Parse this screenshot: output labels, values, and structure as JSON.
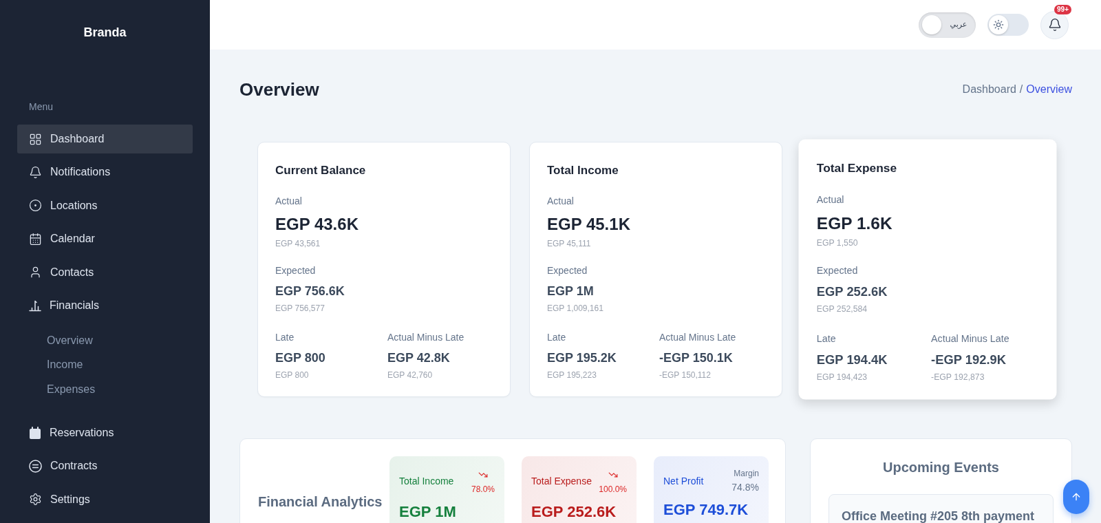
{
  "sidebar": {
    "brand": "Branda",
    "section_label": "Menu",
    "items": [
      {
        "label": "Dashboard",
        "selected": true
      },
      {
        "label": "Notifications",
        "selected": false
      },
      {
        "label": "Locations",
        "selected": false
      },
      {
        "label": "Calendar",
        "selected": false
      },
      {
        "label": "Contacts",
        "selected": false
      },
      {
        "label": "Financials",
        "selected": false,
        "expanded": true,
        "children": [
          {
            "label": "Overview",
            "selected": false
          },
          {
            "label": "Income",
            "selected": false
          },
          {
            "label": "Expenses",
            "selected": false
          }
        ]
      },
      {
        "label": "Reservations",
        "selected": false
      },
      {
        "label": "Contracts",
        "selected": false
      },
      {
        "label": "Settings",
        "selected": false
      }
    ]
  },
  "header": {
    "language_toggle": {
      "label": "عربي",
      "on": false
    },
    "theme_toggle": {
      "on": false
    },
    "notifications": {
      "badge": "99+"
    }
  },
  "page": {
    "title": "Overview",
    "breadcrumb": {
      "separator": "/",
      "items": [
        {
          "label": "Dashboard",
          "current": false
        },
        {
          "label": "Overview",
          "current": true
        }
      ]
    }
  },
  "summary_cards": [
    {
      "title": "Current Balance",
      "hovered": false,
      "actual": {
        "label": "Actual",
        "value": "EGP 43.6K",
        "exact": "EGP 43,561"
      },
      "expected": {
        "label": "Expected",
        "value": "EGP 756.6K",
        "exact": "EGP 756,577"
      },
      "late": {
        "label": "Late",
        "value": "EGP 800",
        "exact": "EGP 800"
      },
      "actual_minus_late": {
        "label": "Actual Minus Late",
        "value": "EGP 42.8K",
        "exact": "EGP 42,760"
      }
    },
    {
      "title": "Total Income",
      "hovered": false,
      "actual": {
        "label": "Actual",
        "value": "EGP 45.1K",
        "exact": "EGP 45,111"
      },
      "expected": {
        "label": "Expected",
        "value": "EGP 1M",
        "exact": "EGP 1,009,161"
      },
      "late": {
        "label": "Late",
        "value": "EGP 195.2K",
        "exact": "EGP 195,223"
      },
      "actual_minus_late": {
        "label": "Actual Minus Late",
        "value": "-EGP 150.1K",
        "exact": "-EGP 150,112"
      }
    },
    {
      "title": "Total Expense",
      "hovered": true,
      "actual": {
        "label": "Actual",
        "value": "EGP 1.6K",
        "exact": "EGP 1,550"
      },
      "expected": {
        "label": "Expected",
        "value": "EGP 252.6K",
        "exact": "EGP 252,584"
      },
      "late": {
        "label": "Late",
        "value": "EGP 194.4K",
        "exact": "EGP 194,423"
      },
      "actual_minus_late": {
        "label": "Actual Minus Late",
        "value": "-EGP 192.9K",
        "exact": "-EGP 192,873"
      }
    }
  ],
  "analytics": {
    "title": "Financial Analytics",
    "tiles": [
      {
        "kind": "trend",
        "label": "Total Income",
        "declining": true,
        "change": "78.0%",
        "value": "EGP 1M",
        "color": "#15803d"
      },
      {
        "kind": "trend",
        "label": "Total Expense",
        "declining": true,
        "change": "100.0%",
        "value": "EGP 252.6K",
        "color": "#b91c1c"
      },
      {
        "kind": "margin",
        "label": "Net Profit",
        "caption": "Margin",
        "change": "74.8%",
        "value": "EGP 749.7K",
        "color": "#1d4ed8"
      }
    ]
  },
  "upcoming_events": {
    "title": "Upcoming Events",
    "events": [
      {
        "title": "Office Meeting #205 8th payment"
      }
    ]
  }
}
